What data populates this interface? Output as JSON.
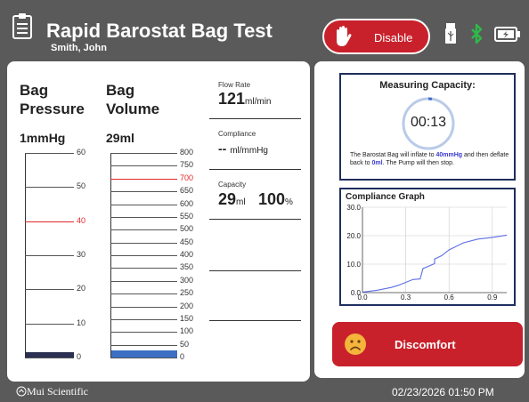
{
  "header": {
    "title": "Rapid Barostat Bag Test",
    "patient": "Smith, John",
    "disable_label": "Disable",
    "icons": [
      "clipboard-icon",
      "hand-icon",
      "usb-icon",
      "bluetooth-icon",
      "battery-charging-icon"
    ]
  },
  "pressure": {
    "heading": "Bag Pressure",
    "value": "1",
    "unit": "mmHg",
    "ticks": [
      "60",
      "50",
      "40",
      "30",
      "20",
      "10",
      "0"
    ],
    "fill": {
      "value": 1,
      "max": 60
    },
    "highlight_tick": "40"
  },
  "volume": {
    "heading": "Bag Volume",
    "value": "29",
    "unit": "ml",
    "ticks": [
      "800",
      "750",
      "700",
      "650",
      "600",
      "550",
      "500",
      "450",
      "400",
      "350",
      "300",
      "250",
      "200",
      "150",
      "100",
      "50",
      "0"
    ],
    "fill": {
      "value": 29,
      "max": 800
    },
    "highlight_tick": "700"
  },
  "metrics": {
    "flow_label": "Flow Rate",
    "flow_value": "121",
    "flow_unit": "ml/min",
    "compliance_label": "Compliance",
    "compliance_value": "--",
    "compliance_unit": "ml/mmHg",
    "capacity_label": "Capacity",
    "capacity_value": "29",
    "capacity_unit": "ml",
    "capacity_percent": "100",
    "capacity_percent_unit": "%"
  },
  "capacity_panel": {
    "title": "Measuring Capacity:",
    "timer": "00:13",
    "desc_1": "The Barostat Bag will inflate to ",
    "desc_pressure": "40mmHg",
    "desc_2": " and then deflate back to ",
    "desc_zero": "0ml",
    "desc_3": ". The Pump will then stop."
  },
  "chart_data": {
    "type": "line",
    "title": "Compliance Graph",
    "xlabel": "",
    "ylabel": "",
    "xlim": [
      0,
      1.0
    ],
    "ylim": [
      0,
      30
    ],
    "x_ticks": [
      "0.0",
      "0.3",
      "0.6",
      "0.9"
    ],
    "y_ticks": [
      "30.0",
      "20.0",
      "10.0",
      "0.0"
    ],
    "x": [
      0,
      0.1,
      0.2,
      0.25,
      0.3,
      0.35,
      0.4,
      0.42,
      0.43,
      0.5,
      0.5,
      0.55,
      0.6,
      0.7,
      0.8,
      0.9,
      1.0
    ],
    "y": [
      0.2,
      0.8,
      1.8,
      2.6,
      3.6,
      4.6,
      4.8,
      8.5,
      8.7,
      10.2,
      11.8,
      13,
      15,
      17.5,
      18.8,
      19.4,
      20.2
    ],
    "line_color": "#5b6ee8",
    "grid": true
  },
  "discomfort": {
    "label": "Discomfort",
    "icon": "sad-face-icon"
  },
  "footer": {
    "logo": "Mui Scientific",
    "datetime": "02/23/2026 01:50 PM"
  },
  "colors": {
    "accent_red": "#c8212b",
    "navy": "#1f2e5e",
    "fill_pressure": "#2b2f52",
    "fill_volume": "#3d6fc4",
    "ring": "#b9cbe8"
  }
}
